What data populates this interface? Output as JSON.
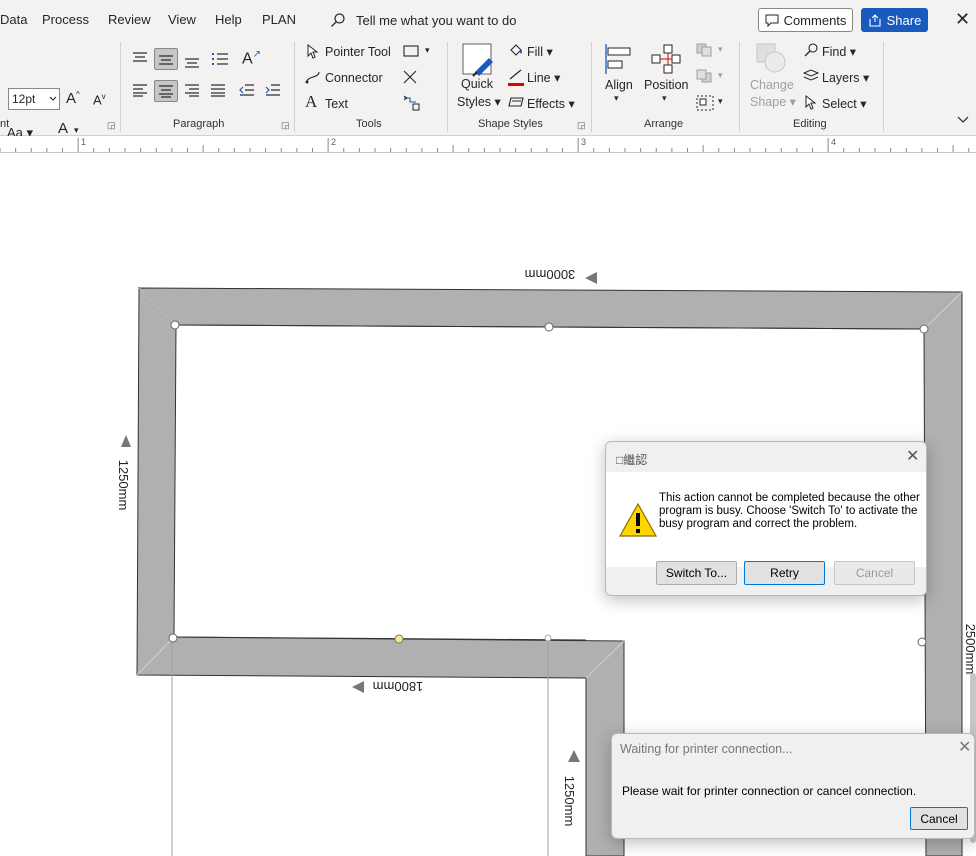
{
  "menu": {
    "items": [
      "Data",
      "Process",
      "Review",
      "View",
      "Help",
      "PLAN"
    ],
    "tell_me": "Tell me what you want to do",
    "comments_label": "Comments",
    "share_label": "Share"
  },
  "ribbon": {
    "font": {
      "size_value": "12pt",
      "grow": "A",
      "shrink": "A",
      "change_case": "Aa",
      "font_color": "A",
      "label": "nt"
    },
    "paragraph": {
      "label": "Paragraph"
    },
    "tools": {
      "pointer_tool": "Pointer Tool",
      "connector": "Connector",
      "text": "Text",
      "label": "Tools"
    },
    "shape_styles": {
      "quick_styles_1": "Quick",
      "quick_styles_2": "Styles",
      "fill": "Fill",
      "line": "Line",
      "effects": "Effects",
      "label": "Shape Styles"
    },
    "arrange": {
      "align": "Align",
      "position": "Position",
      "label": "Arrange"
    },
    "editing": {
      "change_shape_1": "Change",
      "change_shape_2": "Shape",
      "find": "Find",
      "layers": "Layers",
      "select": "Select",
      "label": "Editing"
    }
  },
  "ruler": {
    "numbers": [
      "1",
      "2",
      "3",
      "4"
    ]
  },
  "drawing": {
    "dim_top": "3000mm",
    "dim_left": "1250mm",
    "dim_bottom": "1800mm",
    "dim_bottom_right": "1250mm",
    "dim_right_partial": "2500mm"
  },
  "busy_dialog": {
    "title": "□繼認",
    "message_line1": "This action cannot be completed because the other",
    "message_line2": "program is busy. Choose 'Switch To' to activate the",
    "message_line3": "busy program and correct the problem.",
    "switch_to": "Switch To...",
    "retry": "Retry",
    "cancel": "Cancel"
  },
  "printer_dialog": {
    "title": "Waiting for printer connection...",
    "message": "Please wait for printer connection or cancel connection.",
    "cancel": "Cancel"
  },
  "colors": {
    "share_blue": "#185abd",
    "wall_gray": "#b0b0b0",
    "font_color_bar": "#000000",
    "line_color_bar": "#e00000"
  }
}
